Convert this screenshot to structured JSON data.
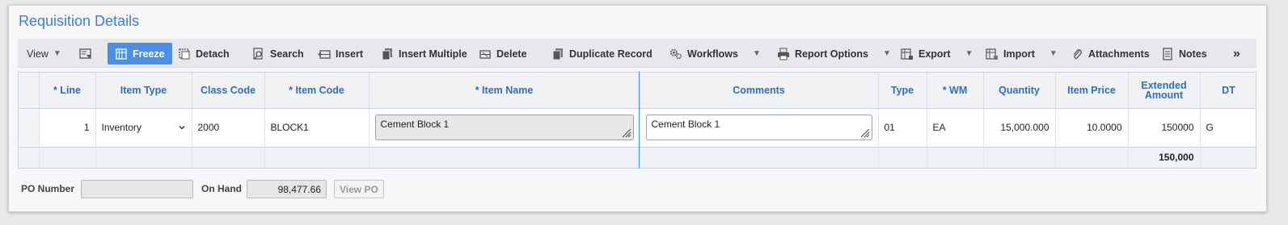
{
  "title": "Requisition Details",
  "toolbar": {
    "view": "View",
    "freeze": "Freeze",
    "detach": "Detach",
    "search": "Search",
    "insert": "Insert",
    "insert_multiple": "Insert Multiple",
    "delete": "Delete",
    "duplicate_record": "Duplicate Record",
    "workflows": "Workflows",
    "report_options": "Report Options",
    "export": "Export",
    "import": "Import",
    "attachments": "Attachments",
    "notes": "Notes",
    "accent_color": "#4b8ee8"
  },
  "grid": {
    "columns": [
      "* Line",
      "Item Type",
      "Class Code",
      "* Item Code",
      "* Item Name",
      "Comments",
      "Type",
      "* WM",
      "Quantity",
      "Item Price",
      "Extended Amount",
      "DT"
    ],
    "row": {
      "line": "1",
      "item_type": "Inventory",
      "class_code": "2000",
      "item_code": "BLOCK1",
      "item_name": "Cement Block 1",
      "comments": "Cement Block 1",
      "type": "01",
      "wm": "EA",
      "quantity": "15,000.000",
      "item_price": "10.0000",
      "extended_amount": "150000",
      "dt": "G"
    },
    "total_extended_amount": "150,000"
  },
  "footer": {
    "po_number_label": "PO Number",
    "po_number_value": "",
    "on_hand_label": "On Hand",
    "on_hand_value": "98,477.66",
    "view_po": "View PO"
  }
}
